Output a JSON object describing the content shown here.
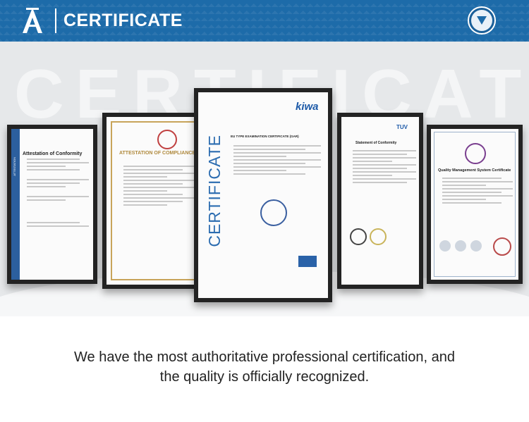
{
  "header": {
    "title": "CERTIFICATE",
    "logo_icon": "brand-a-logo",
    "dropdown_icon": "chevron-down-icon",
    "accent_color": "#1d6ba9"
  },
  "background_word": "CERTIFICATE",
  "certificates": [
    {
      "title": "Attestation of Conformity",
      "side_label": "ATTESTATION"
    },
    {
      "title": "ATTESTATION OF COMPLIANCE"
    },
    {
      "title": "EU TYPE EXAMINATION CERTIFICATE (GAR)",
      "side_label": "CERTIFICATE",
      "brand": "kiwa"
    },
    {
      "title": "Statement of Conformity",
      "brand": "TUV"
    },
    {
      "title": "Quality Management System Certificate"
    }
  ],
  "caption": {
    "line1": "We have the most authoritative professional certification, and",
    "line2": "the quality is officially recognized."
  }
}
